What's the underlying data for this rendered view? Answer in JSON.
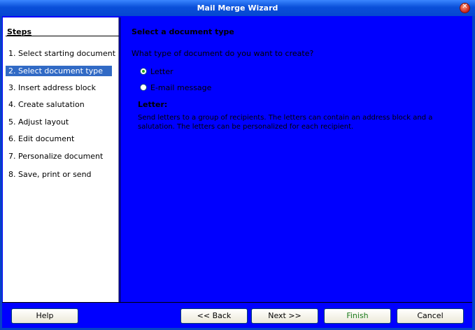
{
  "window": {
    "title": "Mail Merge Wizard"
  },
  "steps": {
    "heading": "Steps",
    "items": [
      {
        "label": "1.  Select starting document"
      },
      {
        "label": "2.  Select document type"
      },
      {
        "label": "3.  Insert address block"
      },
      {
        "label": "4.  Create salutation"
      },
      {
        "label": "5.  Adjust layout"
      },
      {
        "label": "6.  Edit document"
      },
      {
        "label": "7.  Personalize document"
      },
      {
        "label": "8.  Save, print or send"
      }
    ],
    "active_index": 1
  },
  "main": {
    "title": "Select a document type",
    "question": "What type of document do you want to create?",
    "options": [
      {
        "label": "Letter",
        "checked": true
      },
      {
        "label": "E-mail message",
        "checked": false
      }
    ],
    "desc_title": "Letter:",
    "desc_text": "Send letters to a group of recipients. The letters can contain an address block and a salutation. The letters can be personalized for each recipient."
  },
  "buttons": {
    "help": "Help",
    "back": "<< Back",
    "next": "Next >>",
    "finish": "Finish",
    "cancel": "Cancel"
  },
  "colors": {
    "background": "#0000ff",
    "selection": "#316ac5",
    "titlebar": "#0a4fd9"
  },
  "icons": {
    "close": "close-icon"
  }
}
